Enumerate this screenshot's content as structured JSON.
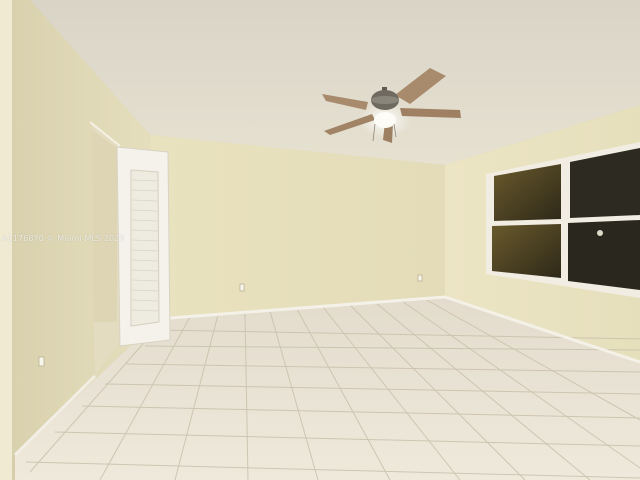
{
  "watermark": "A1176870 © Miami MLS 2025"
}
